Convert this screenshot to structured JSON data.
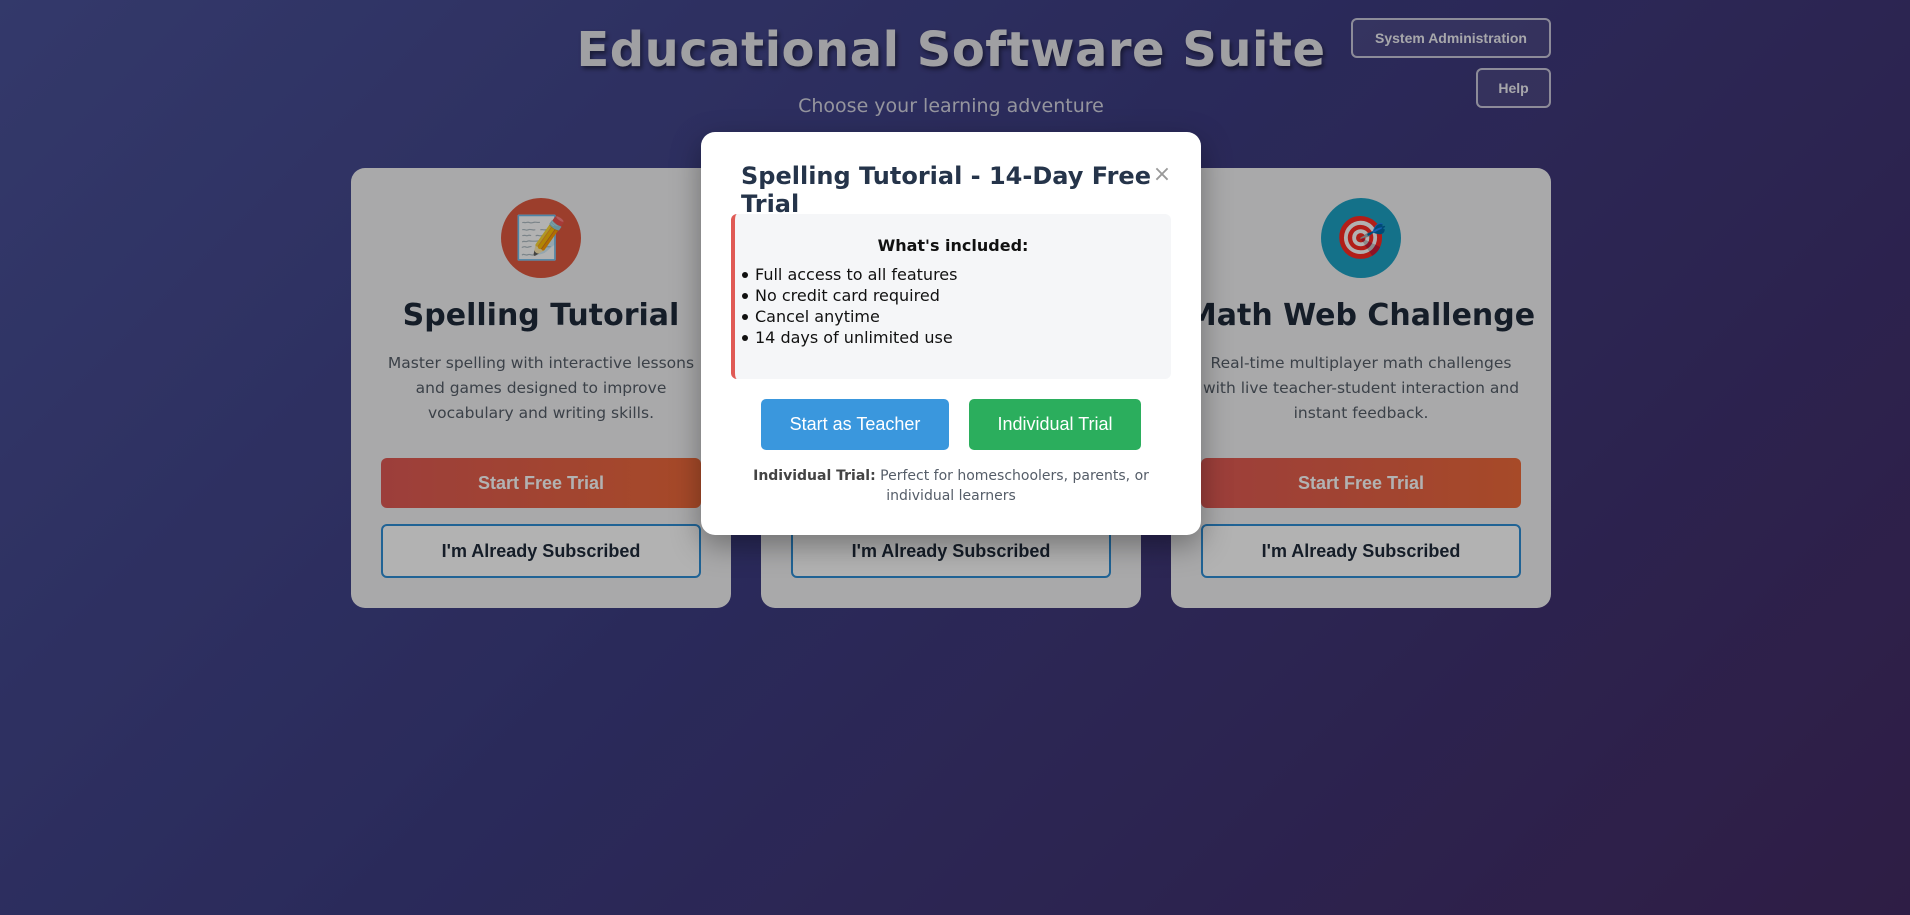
{
  "header": {
    "title": "Educational Software Suite",
    "subtitle": "Choose your learning adventure",
    "admin_button": "System Administration",
    "help_button": "Help"
  },
  "cards": [
    {
      "icon": "📝",
      "icon_name": "memo-icon",
      "icon_bg": "#e05a40",
      "title": "Spelling Tutorial",
      "description": "Master spelling with interactive lessons and games designed to improve vocabulary and writing skills.",
      "trial_button": "Start Free Trial",
      "subscribed_button": "I'm Already Subscribed"
    },
    {
      "subscribed_button": "I'm Already Subscribed"
    },
    {
      "icon": "🎯",
      "icon_name": "target-icon",
      "icon_bg": "#1ea2c4",
      "title": "Math Web Challenge",
      "description": "Real-time multiplayer math challenges with live teacher-student interaction and instant feedback.",
      "trial_button": "Start Free Trial",
      "subscribed_button": "I'm Already Subscribed"
    }
  ],
  "modal": {
    "title": "Spelling Tutorial - 14-Day Free Trial",
    "close": "×",
    "included_title": "What's included:",
    "included_items": [
      "Full access to all features",
      "No credit card required",
      "Cancel anytime",
      "14 days of unlimited use"
    ],
    "teacher_button": "Start as Teacher",
    "individual_button": "Individual Trial",
    "note_label": "Individual Trial:",
    "note_text": " Perfect for homeschoolers, parents, or individual learners"
  },
  "colors": {
    "accent_blue": "#3a97dd",
    "accent_green": "#2bae5d",
    "accent_red": "#e05a55"
  }
}
